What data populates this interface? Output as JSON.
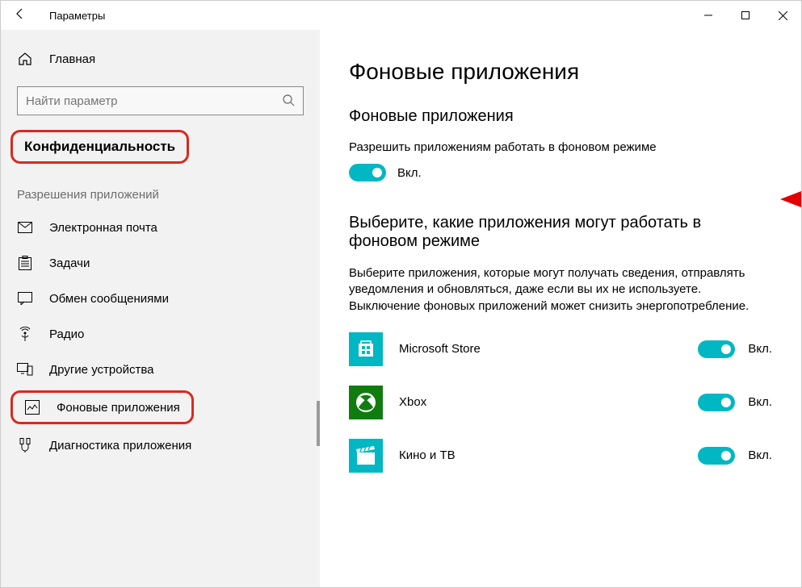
{
  "window": {
    "title": "Параметры"
  },
  "sidebar": {
    "home": "Главная",
    "search_placeholder": "Найти параметр",
    "section": "Конфиденциальность",
    "group_label": "Разрешения приложений",
    "items": [
      {
        "label": "Электронная почта"
      },
      {
        "label": "Задачи"
      },
      {
        "label": "Обмен сообщениями"
      },
      {
        "label": "Радио"
      },
      {
        "label": "Другие устройства"
      },
      {
        "label": "Фоновые приложения"
      },
      {
        "label": "Диагностика приложения"
      }
    ]
  },
  "main": {
    "title": "Фоновые приложения",
    "section1_title": "Фоновые приложения",
    "setting_label": "Разрешить приложениям работать в фоновом режиме",
    "toggle_on": "Вкл.",
    "section2_title": "Выберите, какие приложения могут работать в фоновом режиме",
    "help": "Выберите приложения, которые могут получать сведения, отправлять уведомления и обновляться, даже если вы их не используете. Выключение фоновых приложений может снизить энергопотребление.",
    "apps": [
      {
        "name": "Microsoft Store",
        "state": "Вкл."
      },
      {
        "name": "Xbox",
        "state": "Вкл."
      },
      {
        "name": "Кино и ТВ",
        "state": "Вкл."
      }
    ]
  }
}
